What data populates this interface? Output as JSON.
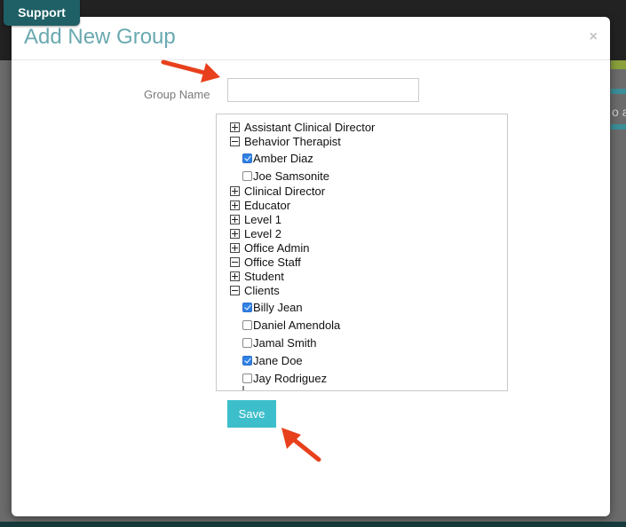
{
  "support_tab": {
    "label": "Support"
  },
  "background": {
    "partial_text": "o a"
  },
  "modal": {
    "title": "Add New Group",
    "close_icon": "×",
    "group_name": {
      "label": "Group Name",
      "value": "",
      "placeholder": ""
    },
    "tree": {
      "nodes": [
        {
          "type": "group",
          "label": "Assistant Clinical Director",
          "expanded": false
        },
        {
          "type": "group",
          "label": "Behavior Therapist",
          "expanded": true
        },
        {
          "type": "member",
          "label": "Amber Diaz",
          "checked": true
        },
        {
          "type": "member",
          "label": "Joe Samsonite",
          "checked": false
        },
        {
          "type": "group",
          "label": "Clinical Director",
          "expanded": false
        },
        {
          "type": "group",
          "label": "Educator",
          "expanded": false
        },
        {
          "type": "group",
          "label": "Level 1",
          "expanded": false
        },
        {
          "type": "group",
          "label": "Level 2",
          "expanded": false
        },
        {
          "type": "group",
          "label": "Office Admin",
          "expanded": false
        },
        {
          "type": "group",
          "label": "Office Staff",
          "expanded": true
        },
        {
          "type": "group",
          "label": "Student",
          "expanded": false
        },
        {
          "type": "group",
          "label": "Clients",
          "expanded": true
        },
        {
          "type": "member",
          "label": "Billy Jean",
          "checked": true
        },
        {
          "type": "member",
          "label": "Daniel Amendola",
          "checked": false
        },
        {
          "type": "member",
          "label": "Jamal Smith",
          "checked": false
        },
        {
          "type": "member",
          "label": "Jane Doe",
          "checked": true
        },
        {
          "type": "member",
          "label": "Jay Rodriguez",
          "checked": false
        }
      ]
    },
    "save_label": "Save"
  },
  "colors": {
    "accent": "#3dbfcb",
    "title": "#6aa9b0",
    "support_tab": "#1f6066",
    "checkbox_checked": "#2f82e6",
    "annotation_arrow": "#e8401c"
  },
  "icons": {
    "collapsed": "plus-box-icon",
    "expanded": "minus-box-icon",
    "close": "close-icon",
    "annotation": "red-arrow-icon"
  }
}
